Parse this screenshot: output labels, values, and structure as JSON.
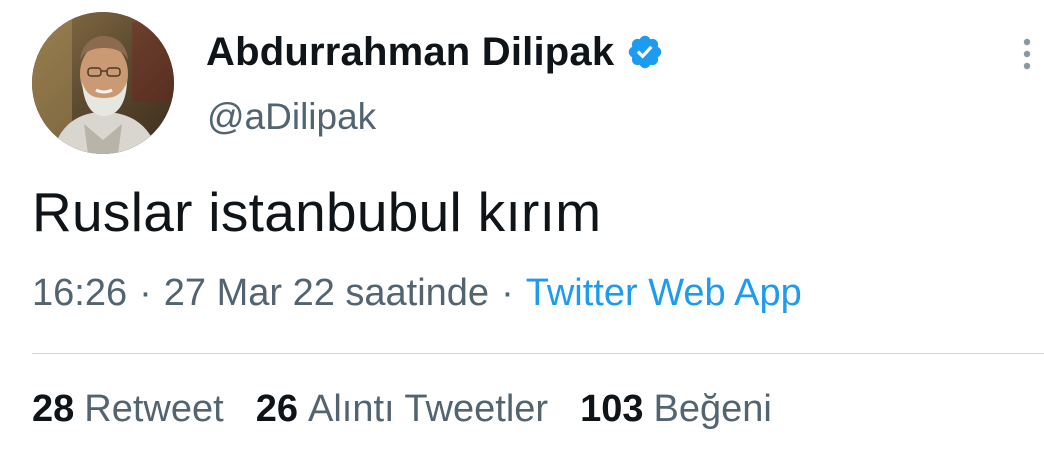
{
  "tweet": {
    "author": {
      "display_name": "Abdurrahman Dilipak",
      "handle": "@aDilipak",
      "verified": true,
      "avatar_icon": "profile-photo"
    },
    "text": "Ruslar istanbubul kırım",
    "time": "16:26",
    "date": "27 Mar 22 saatinde",
    "separator": "·",
    "source": "Twitter Web App",
    "more_icon": "more-vertical-icon",
    "stats": [
      {
        "count": "28",
        "label": "Retweet"
      },
      {
        "count": "26",
        "label": "Alıntı Tweetler"
      },
      {
        "count": "103",
        "label": "Beğeni"
      }
    ]
  },
  "colors": {
    "text_primary": "#0f1419",
    "text_secondary": "#536471",
    "link": "#1d9bf0",
    "verified_badge": "#1d9bf0",
    "divider": "#cfd9de"
  }
}
